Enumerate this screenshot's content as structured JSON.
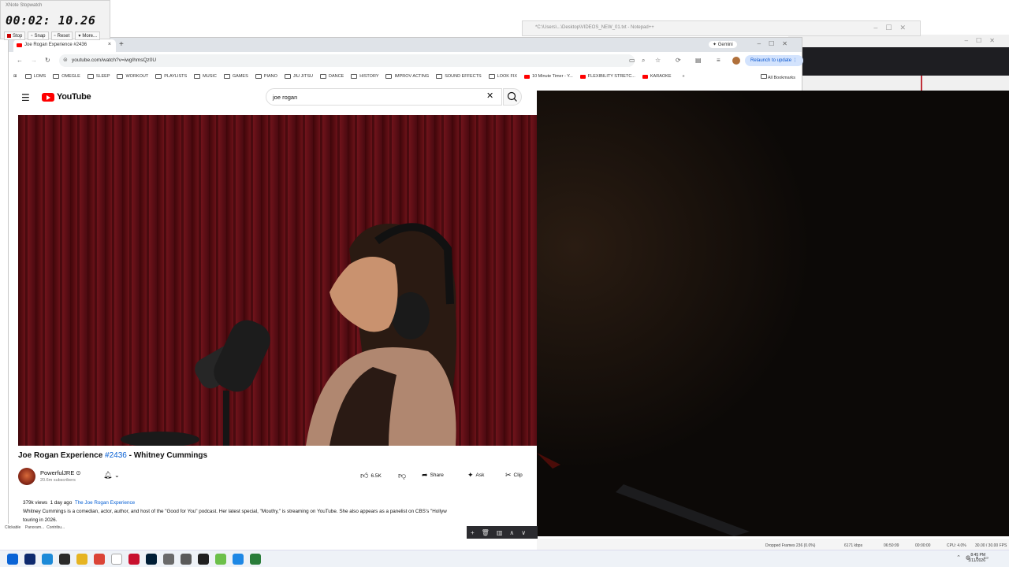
{
  "stopwatch": {
    "title": "XNote Stopwatch",
    "time": "00:02: 10.26",
    "buttons": [
      "Stop",
      "Snap",
      "Reset",
      "More..."
    ]
  },
  "notepad": {
    "title": "*C:\\Users\\...\\Desktop\\VIDEOS_NEW_01.txt - Notepad++"
  },
  "browser": {
    "tab_title": "Joe Rogan Experience #2436",
    "gemini": "Gemini",
    "url": "youtube.com/watch?v=iwgIhmsQz0U",
    "relaunch": "Relaunch to update",
    "bookmarks": [
      "LOMS",
      "OMEGLE",
      "SLEEP",
      "WORKOUT",
      "PLAYLISTS",
      "MUSIC",
      "GAMES",
      "PIANO",
      "JIU JITSU",
      "DANCE",
      "HISTORY",
      "IMPROV ACTING",
      "SOUND EFFECTS",
      "LOOK FIX",
      "10 Minute Timer - Y...",
      "FLEXIBILITY STRETC...",
      "KARAOKE"
    ],
    "bookmark_icons": [
      "folder",
      "folder",
      "folder",
      "folder",
      "folder",
      "folder",
      "folder",
      "folder",
      "folder",
      "folder",
      "folder",
      "folder",
      "folder",
      "folder",
      "youtube",
      "youtube",
      "youtube"
    ],
    "all_bookmarks": "All Bookmarks"
  },
  "youtube": {
    "logo_text": "YouTube",
    "search_value": "joe rogan",
    "video_title_prefix": "Joe Rogan Experience ",
    "video_title_tag": "#2436",
    "video_title_suffix": " - Whitney Cummings",
    "channel_name": "PowerfulJRE ⊙",
    "channel_subs": "20.6m subscribers",
    "like_count": "6.5K",
    "share_label": "Share",
    "ask_label": "Ask",
    "clip_label": "Clip",
    "views": "379k views",
    "posted": "1 day ago",
    "desc_link": "The Joe Rogan Experience",
    "description": "Whitney Cummings is a comedian, actor, author, and host of the \"Good for You\" podcast. Her latest special, \"Mouthy,\" is streaming on YouTube. She also appears as a panelist on CBS's \"Hollyw",
    "description_line2": "touring in 2026."
  },
  "obs_status": {
    "dropped": "Dropped Frames 236 (0.0%)",
    "kbps": "6171 kbps",
    "rec": "06:50:09",
    "live": "00:00:00",
    "cpu": "CPU: 4.0%",
    "fps": "30.00 / 30.00 FPS"
  },
  "bottom_left": [
    "Clickable",
    "Panoram...",
    "Contribu..."
  ],
  "clock": {
    "time": "8:45 PM",
    "date": "1/11/2026"
  },
  "taskbar_icons": [
    "windows-start",
    "terminal",
    "edge",
    "app",
    "file-explorer",
    "chrome",
    "document",
    "app-red",
    "photoshop",
    "settings",
    "clock",
    "obs",
    "notepad-plus",
    "app-blue",
    "calculator"
  ],
  "taskbar_colors": [
    "#0a64d6",
    "#0e2a6e",
    "#1c8ad8",
    "#2a2a2a",
    "#e6b422",
    "#db4437",
    "#ffffff",
    "#c8102e",
    "#001e36",
    "#6a6a6a",
    "#5a5a5a",
    "#202020",
    "#6cc04a",
    "#1e88e5",
    "#2a7d3a"
  ]
}
